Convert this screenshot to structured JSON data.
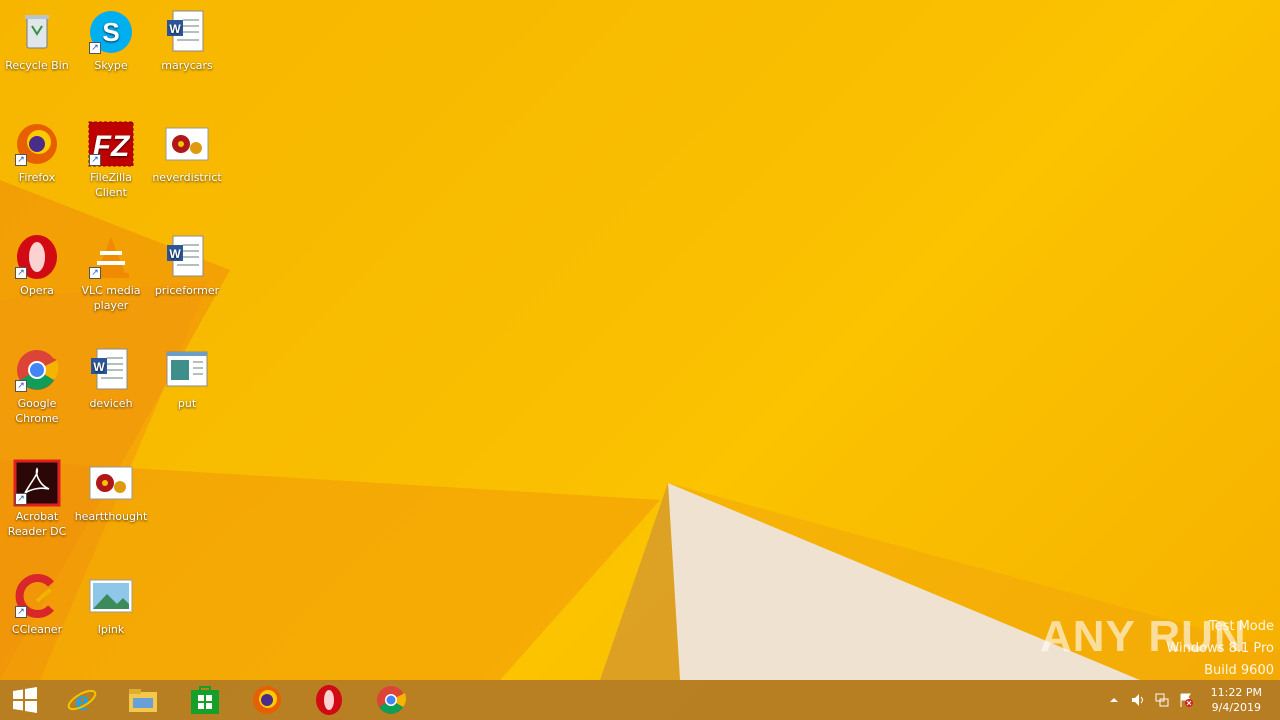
{
  "desktop": {
    "icons": [
      {
        "label": "Recycle Bin",
        "icon": "recycle-bin-icon"
      },
      {
        "label": "Skype",
        "icon": "skype-icon"
      },
      {
        "label": "marycars",
        "icon": "word-document-icon"
      },
      {
        "label": "Firefox",
        "icon": "firefox-icon"
      },
      {
        "label": "FileZilla Client",
        "icon": "filezilla-icon"
      },
      {
        "label": "neverdistrict",
        "icon": "image-file-icon"
      },
      {
        "label": "Opera",
        "icon": "opera-icon"
      },
      {
        "label": "VLC media player",
        "icon": "vlc-icon"
      },
      {
        "label": "priceformer",
        "icon": "word-document-icon"
      },
      {
        "label": "Google Chrome",
        "icon": "chrome-icon"
      },
      {
        "label": "deviceh",
        "icon": "word-document-icon"
      },
      {
        "label": "put",
        "icon": "generic-file-icon"
      },
      {
        "label": "Acrobat Reader DC",
        "icon": "acrobat-icon"
      },
      {
        "label": "heartthought",
        "icon": "image-file-icon"
      },
      {
        "label": "CCleaner",
        "icon": "ccleaner-icon"
      },
      {
        "label": "lpink",
        "icon": "landscape-image-icon"
      }
    ]
  },
  "watermark": {
    "line1": "Test Mode",
    "line2": "Windows 8.1 Pro",
    "line3": "Build 9600",
    "brand": "ANY RUN"
  },
  "taskbar": {
    "items": [
      {
        "name": "start-button",
        "icon": "windows-logo-icon"
      },
      {
        "name": "internet-explorer",
        "icon": "internet-explorer-icon"
      },
      {
        "name": "file-explorer",
        "icon": "file-explorer-icon"
      },
      {
        "name": "store",
        "icon": "store-icon"
      },
      {
        "name": "firefox",
        "icon": "firefox-icon"
      },
      {
        "name": "opera",
        "icon": "opera-icon"
      },
      {
        "name": "chrome",
        "icon": "chrome-icon"
      }
    ],
    "clock": {
      "time": "11:22 PM",
      "date": "9/4/2019"
    }
  },
  "colors": {
    "wallpaper": "#f9be00",
    "taskbar": "#ac7428"
  }
}
